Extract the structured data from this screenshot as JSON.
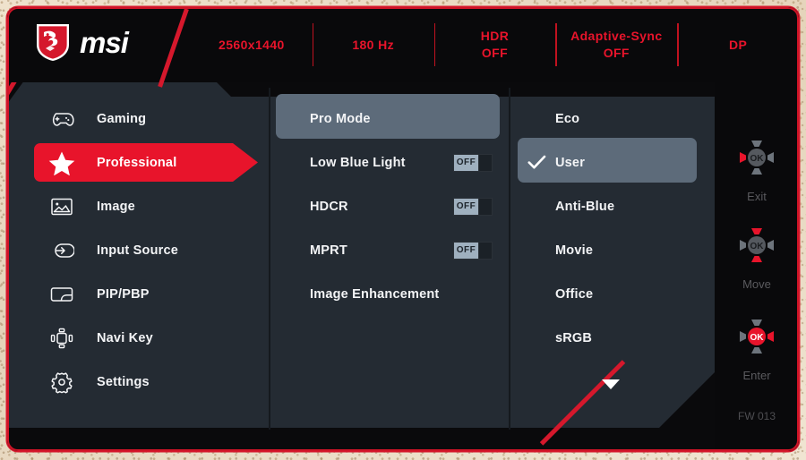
{
  "brand": {
    "logo_icon": "msi-dragon-shield-icon",
    "wordmark": "msi"
  },
  "header": {
    "resolution": "2560x1440",
    "refresh_rate": "180 Hz",
    "hdr_label": "HDR",
    "hdr_value": "OFF",
    "adaptive_sync_label": "Adaptive-Sync",
    "adaptive_sync_value": "OFF",
    "input": "DP"
  },
  "sidebar": {
    "items": [
      {
        "label": "Gaming",
        "icon": "gamepad-icon",
        "active": false
      },
      {
        "label": "Professional",
        "icon": "star-icon",
        "active": true
      },
      {
        "label": "Image",
        "icon": "picture-icon",
        "active": false
      },
      {
        "label": "Input Source",
        "icon": "input-arrow-icon",
        "active": false
      },
      {
        "label": "PIP/PBP",
        "icon": "pip-pbp-icon",
        "active": false
      },
      {
        "label": "Navi Key",
        "icon": "navi-key-icon",
        "active": false
      },
      {
        "label": "Settings",
        "icon": "gear-icon",
        "active": false
      }
    ]
  },
  "middle_column": {
    "items": [
      {
        "label": "Pro Mode",
        "highlighted": true,
        "toggle": null
      },
      {
        "label": "Low Blue Light",
        "highlighted": false,
        "toggle": "OFF"
      },
      {
        "label": "HDCR",
        "highlighted": false,
        "toggle": "OFF"
      },
      {
        "label": "MPRT",
        "highlighted": false,
        "toggle": "OFF"
      },
      {
        "label": "Image Enhancement",
        "highlighted": false,
        "toggle": null
      }
    ]
  },
  "right_column": {
    "items": [
      {
        "label": "Eco",
        "selected": false
      },
      {
        "label": "User",
        "selected": true
      },
      {
        "label": "Anti-Blue",
        "selected": false
      },
      {
        "label": "Movie",
        "selected": false
      },
      {
        "label": "Office",
        "selected": false
      },
      {
        "label": "sRGB",
        "selected": false
      }
    ],
    "scroll_indicator": "chevron-down-icon"
  },
  "nav_panel": {
    "blocks": [
      {
        "label": "Exit",
        "icon": "dpad-left-icon"
      },
      {
        "label": "Move",
        "icon": "dpad-updown-icon"
      },
      {
        "label": "Enter",
        "icon": "dpad-ok-right-icon"
      }
    ],
    "firmware": "FW 013"
  },
  "colors": {
    "accent_red": "#e8142b",
    "panel_bg": "#242b33",
    "header_bg": "#09090b",
    "highlight": "#5d6b7a",
    "text": "#f3f4f6"
  }
}
